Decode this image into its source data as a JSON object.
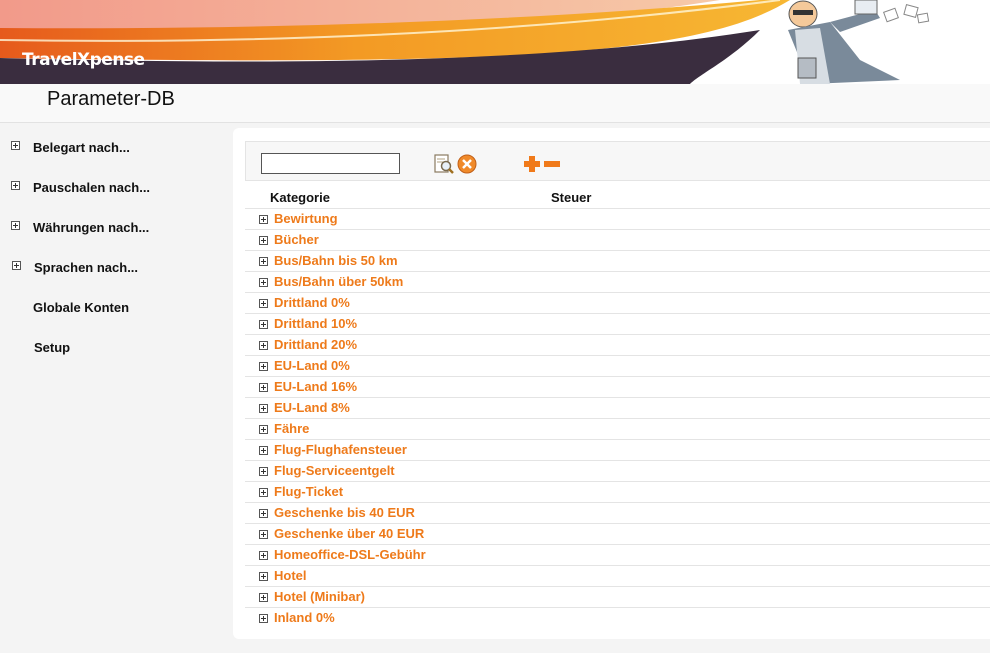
{
  "header": {
    "logo_text": "TravelXpense"
  },
  "page": {
    "title": "Parameter-DB"
  },
  "sidebar": {
    "items": [
      {
        "label": "Belegart nach...",
        "expandable": true
      },
      {
        "label": "Pauschalen nach...",
        "expandable": true
      },
      {
        "label": "Währungen nach...",
        "expandable": true
      },
      {
        "label": "Sprachen nach...",
        "expandable": true
      },
      {
        "label": "Globale Konten",
        "expandable": false
      },
      {
        "label": "Setup",
        "expandable": false
      }
    ]
  },
  "toolbar": {
    "search_value": "",
    "search_icon": "search-icon",
    "clear_icon": "clear-icon",
    "add_icon": "add-icon",
    "remove_icon": "remove-icon"
  },
  "table": {
    "columns": [
      "Kategorie",
      "Steuer"
    ],
    "rows": [
      "Bewirtung",
      "Bücher",
      "Bus/Bahn bis 50 km",
      "Bus/Bahn über 50km",
      "Drittland 0%",
      "Drittland 10%",
      "Drittland 20%",
      "EU-Land 0%",
      "EU-Land 16%",
      "EU-Land 8%",
      "Fähre",
      "Flug-Flughafensteuer",
      "Flug-Serviceentgelt",
      "Flug-Ticket",
      "Geschenke bis 40 EUR",
      "Geschenke über 40 EUR",
      "Homeoffice-DSL-Gebühr",
      "Hotel",
      "Hotel (Minibar)",
      "Inland 0%"
    ]
  },
  "colors": {
    "accent": "#ee7a1a",
    "banner_orange": "#f08a1c",
    "banner_dark": "#3a2d3f"
  }
}
